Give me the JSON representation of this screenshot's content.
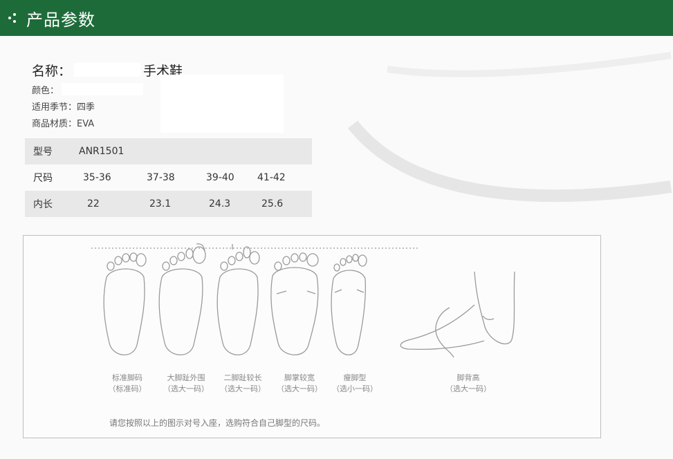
{
  "header": {
    "title": "产品参数"
  },
  "product": {
    "name_label": "名称：",
    "name_value": "手术鞋",
    "color_label": "颜色：",
    "season": "适用季节：四季",
    "material": "商品材质：EVA"
  },
  "size_table": {
    "rows": [
      {
        "label": "型号",
        "cells": [
          "ANR1501",
          "",
          "",
          ""
        ]
      },
      {
        "label": "尺码",
        "cells": [
          "35-36",
          "37-38",
          "39-40",
          "41-42"
        ]
      },
      {
        "label": "内长",
        "cells": [
          "22",
          "23.1",
          "24.3",
          "25.6"
        ]
      }
    ]
  },
  "foot_guide": {
    "captions": [
      {
        "line1": "标准脚码",
        "line2": "（标准码）"
      },
      {
        "line1": "大脚趾外围",
        "line2": "（选大一码）"
      },
      {
        "line1": "二脚趾较长",
        "line2": "（选大一码）"
      },
      {
        "line1": "脚掌较宽",
        "line2": "（选大一码）"
      },
      {
        "line1": "瘦脚型",
        "line2": "（选小一码）"
      },
      {
        "line1": "脚背高",
        "line2": "（选大一码）"
      }
    ],
    "note": "请您按照以上的图示对号入座，选购符合自己脚型的尺码。"
  }
}
